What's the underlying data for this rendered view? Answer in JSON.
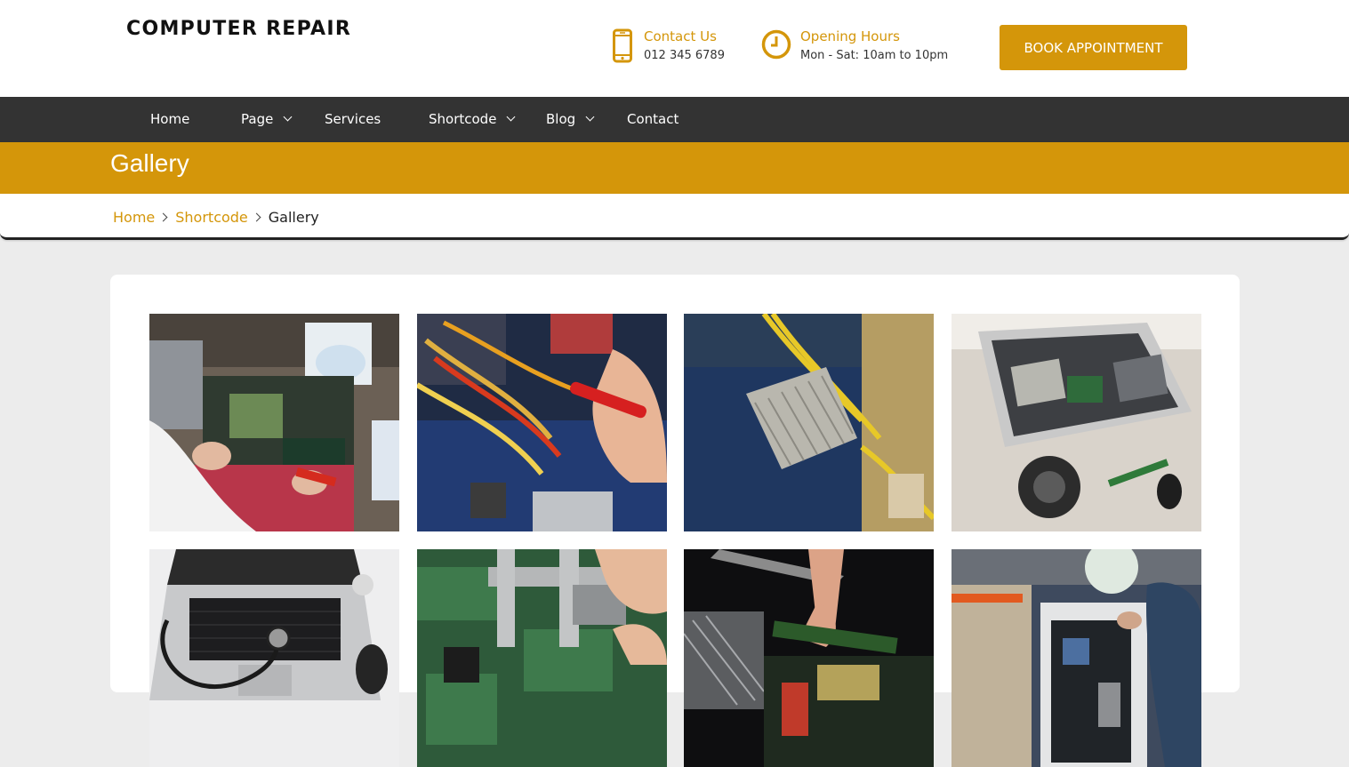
{
  "header": {
    "logo": "COMPUTER REPAIR",
    "contact": {
      "title": "Contact Us",
      "value": "012 345 6789",
      "icon": "phone-icon"
    },
    "hours": {
      "title": "Opening Hours",
      "value": "Mon - Sat: 10am to 10pm",
      "icon": "clock-icon"
    },
    "book_button": "BOOK APPOINTMENT"
  },
  "nav": {
    "items": [
      {
        "label": "Home",
        "has_dropdown": false
      },
      {
        "label": "Page",
        "has_dropdown": true
      },
      {
        "label": "Services",
        "has_dropdown": false
      },
      {
        "label": "Shortcode",
        "has_dropdown": true
      },
      {
        "label": "Blog",
        "has_dropdown": true
      },
      {
        "label": "Contact",
        "has_dropdown": false
      }
    ]
  },
  "page": {
    "title": "Gallery"
  },
  "breadcrumb": {
    "items": [
      "Home",
      "Shortcode"
    ],
    "current": "Gallery"
  },
  "gallery": {
    "images": [
      {
        "subject": "technician-repairing-motherboard-workbench"
      },
      {
        "subject": "hand-holding-cable-inside-pc"
      },
      {
        "subject": "cpu-heatsink-closeup"
      },
      {
        "subject": "opened-imac-with-fan"
      },
      {
        "subject": "laptop-with-stethoscope"
      },
      {
        "subject": "caliper-measuring-circuit-board"
      },
      {
        "subject": "hands-installing-ram"
      },
      {
        "subject": "technician-at-open-pc-tower"
      }
    ]
  },
  "colors": {
    "accent": "#d4960a",
    "nav_bg": "#333333",
    "page_bg": "#ececec"
  }
}
